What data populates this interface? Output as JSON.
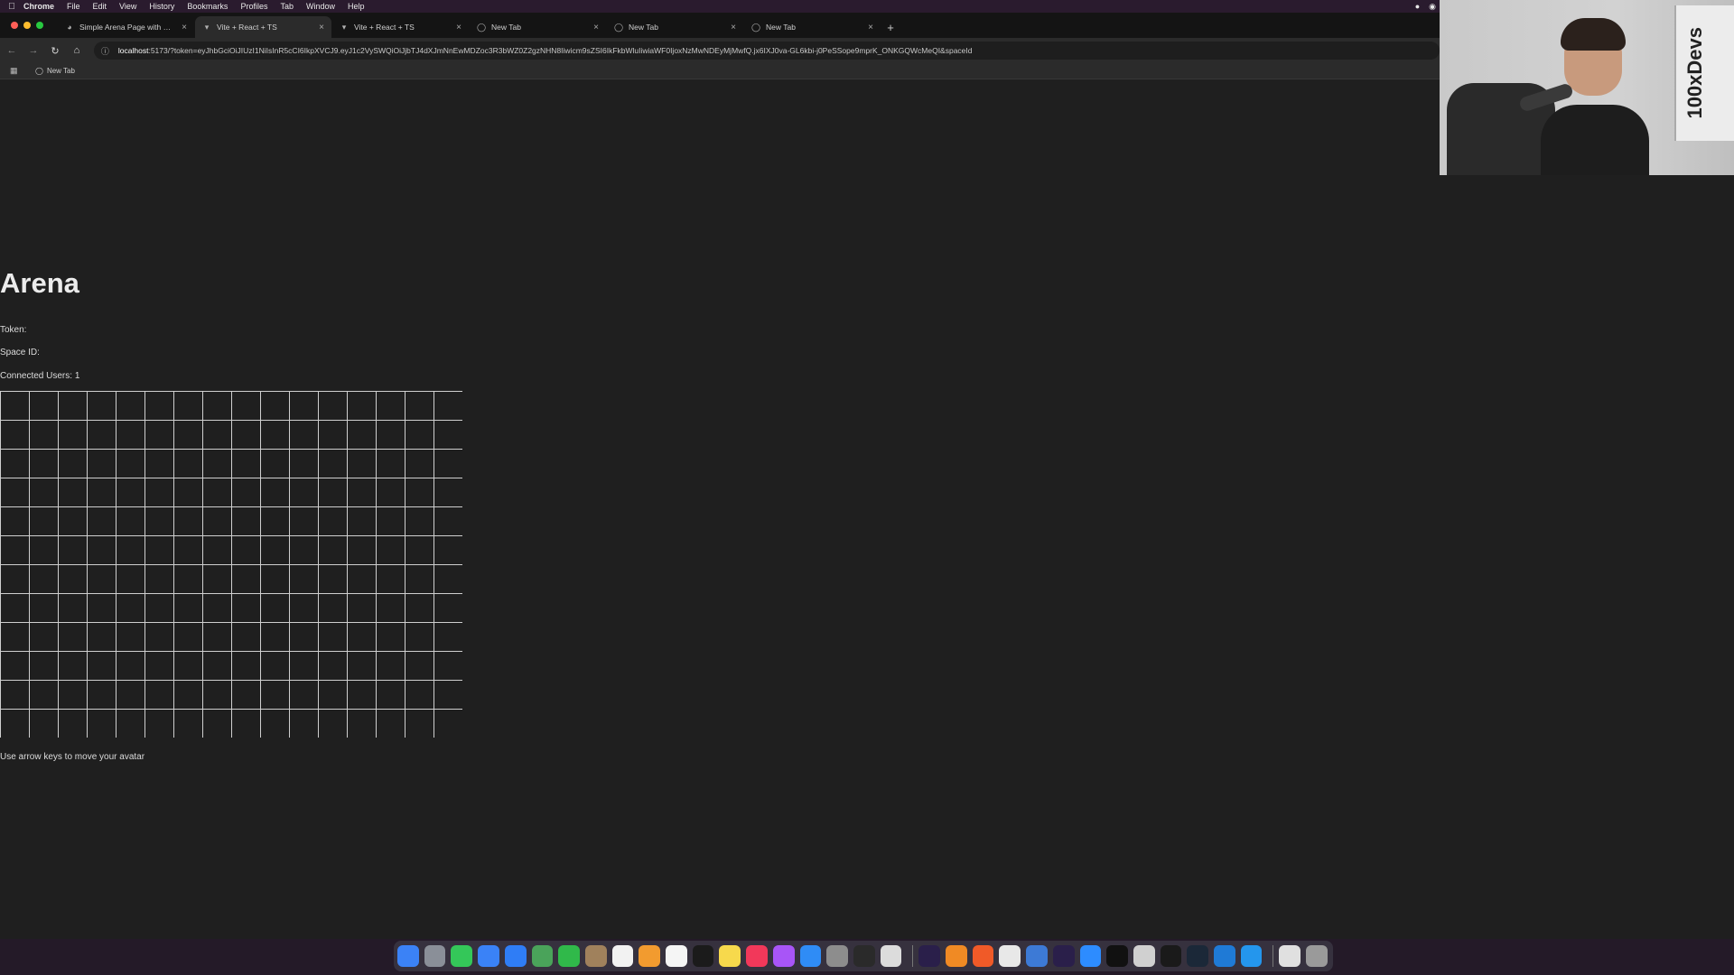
{
  "menubar": {
    "app": "Chrome",
    "items": [
      "File",
      "Edit",
      "View",
      "History",
      "Bookmarks",
      "Profiles",
      "Tab",
      "Window",
      "Help"
    ]
  },
  "tabs": [
    {
      "title": "Simple Arena Page with Canv",
      "active": false,
      "icon": "globe-icon"
    },
    {
      "title": "Vite + React + TS",
      "active": true,
      "icon": "vite-icon"
    },
    {
      "title": "Vite + React + TS",
      "active": false,
      "icon": "vite-icon"
    },
    {
      "title": "New Tab",
      "active": false,
      "icon": "chrome-icon"
    },
    {
      "title": "New Tab",
      "active": false,
      "icon": "chrome-icon"
    },
    {
      "title": "New Tab",
      "active": false,
      "icon": "chrome-icon"
    }
  ],
  "omnibox": {
    "host": "localhost",
    "rest": ":5173/?token=eyJhbGciOiJIUzI1NiIsInR5cCI6IkpXVCJ9.eyJ1c2VySWQiOiJjbTJ4dXJmNnEwMDZoc3R3bWZ0Z2gzNHN8Iiwicm9sZSI6IkFkbWluIiwiaWF0IjoxNzMwNDEyMjMwfQ.jx6IXJ0va-GL6kbi-j0PeSSope9mprK_ONKGQWcMeQI&spaceId"
  },
  "bookmarks": [
    {
      "label": "New Tab"
    }
  ],
  "page": {
    "title": "Arena",
    "token_label": "Token:",
    "space_label": "Space ID:",
    "users_label": "Connected Users: 1",
    "hint": "Use arrow keys to move your avatar"
  },
  "grid": {
    "cols": 16,
    "rows": 12,
    "line_color": "#cfcfcf",
    "background": "#1f1f1f"
  },
  "webcam": {
    "sign_text": "100xDevs"
  },
  "dock": {
    "icons": [
      {
        "name": "finder-icon",
        "color": "#3b82f6"
      },
      {
        "name": "launchpad-icon",
        "color": "#8a8f98"
      },
      {
        "name": "messages-icon",
        "color": "#34c759"
      },
      {
        "name": "mail-icon",
        "color": "#3a82f7"
      },
      {
        "name": "safari-icon",
        "color": "#2f7df6"
      },
      {
        "name": "maps-icon",
        "color": "#4aa35a"
      },
      {
        "name": "facetime-icon",
        "color": "#30b94a"
      },
      {
        "name": "contacts-icon",
        "color": "#a0815c"
      },
      {
        "name": "calendar-icon",
        "color": "#f2f2f2"
      },
      {
        "name": "photos-icon",
        "color": "#f29b2f"
      },
      {
        "name": "reminders-icon",
        "color": "#f5f5f5"
      },
      {
        "name": "appletv-icon",
        "color": "#1b1b1b"
      },
      {
        "name": "notes-icon",
        "color": "#f7d94c"
      },
      {
        "name": "music-icon",
        "color": "#f2385a"
      },
      {
        "name": "podcasts-icon",
        "color": "#a855f7"
      },
      {
        "name": "appstore-icon",
        "color": "#2f8cf6"
      },
      {
        "name": "settings-icon",
        "color": "#8d8d8d"
      },
      {
        "name": "clock-icon",
        "color": "#2a2a2a"
      },
      {
        "name": "preview-icon",
        "color": "#dcdcdc"
      },
      {
        "name": "premiere-icon",
        "color": "#2a1f4a"
      },
      {
        "name": "pencil-icon",
        "color": "#f08a24"
      },
      {
        "name": "brave-icon",
        "color": "#f05a28"
      },
      {
        "name": "chrome-icon",
        "color": "#e8e8e8"
      },
      {
        "name": "browser-icon",
        "color": "#3d7ad6"
      },
      {
        "name": "premiere-icon-2",
        "color": "#2a1f4a"
      },
      {
        "name": "zoom-icon",
        "color": "#2d8cff"
      },
      {
        "name": "terminal-icon",
        "color": "#111111"
      },
      {
        "name": "piano-icon",
        "color": "#d0d0d0"
      },
      {
        "name": "terminal-icon-2",
        "color": "#1a1a1a"
      },
      {
        "name": "steam-icon",
        "color": "#1b2838"
      },
      {
        "name": "vscode-icon",
        "color": "#1f7ad6"
      },
      {
        "name": "docker-icon",
        "color": "#2496ed"
      },
      {
        "name": "document-icon",
        "color": "#e0e0e0"
      },
      {
        "name": "trash-icon",
        "color": "#9a9a9a"
      }
    ]
  }
}
